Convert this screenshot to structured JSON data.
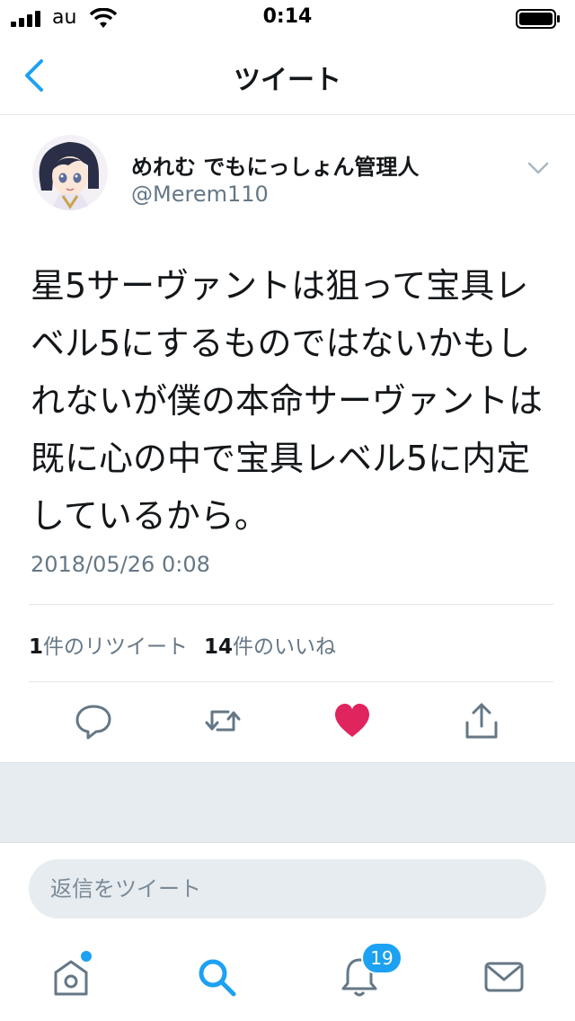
{
  "status_bar": {
    "carrier": "au",
    "time": "0:14"
  },
  "header": {
    "title": "ツイート"
  },
  "tweet": {
    "user_name": "めれむ でもにっしょん管理人",
    "handle": "@Merem110",
    "text": "星5サーヴァントは狙って宝具レベル5にするものではないかもしれないが僕の本命サーヴァントは既に心の中で宝具レベル5に内定しているから。",
    "timestamp": "2018/05/26 0:08",
    "retweet_count": "1",
    "retweet_label": "件のリツイート",
    "like_count": "14",
    "like_label": "件のいいね",
    "liked": true
  },
  "reply": {
    "placeholder": "返信をツイート"
  },
  "tab_bar": {
    "notifications_badge": "19"
  },
  "colors": {
    "accent": "#1da1f2",
    "like": "#e0245e",
    "secondary_text": "#657786",
    "icon_gray": "#657786",
    "divider": "#e1e8ed",
    "band": "#e6ecf0"
  },
  "icons": {
    "back": "chevron-left-icon",
    "caret": "chevron-down-icon",
    "reply": "speech-bubble-icon",
    "retweet": "retweet-icon",
    "like": "heart-icon",
    "share": "share-icon",
    "home": "home-icon",
    "search": "search-icon",
    "notifications": "bell-icon",
    "messages": "envelope-icon"
  }
}
